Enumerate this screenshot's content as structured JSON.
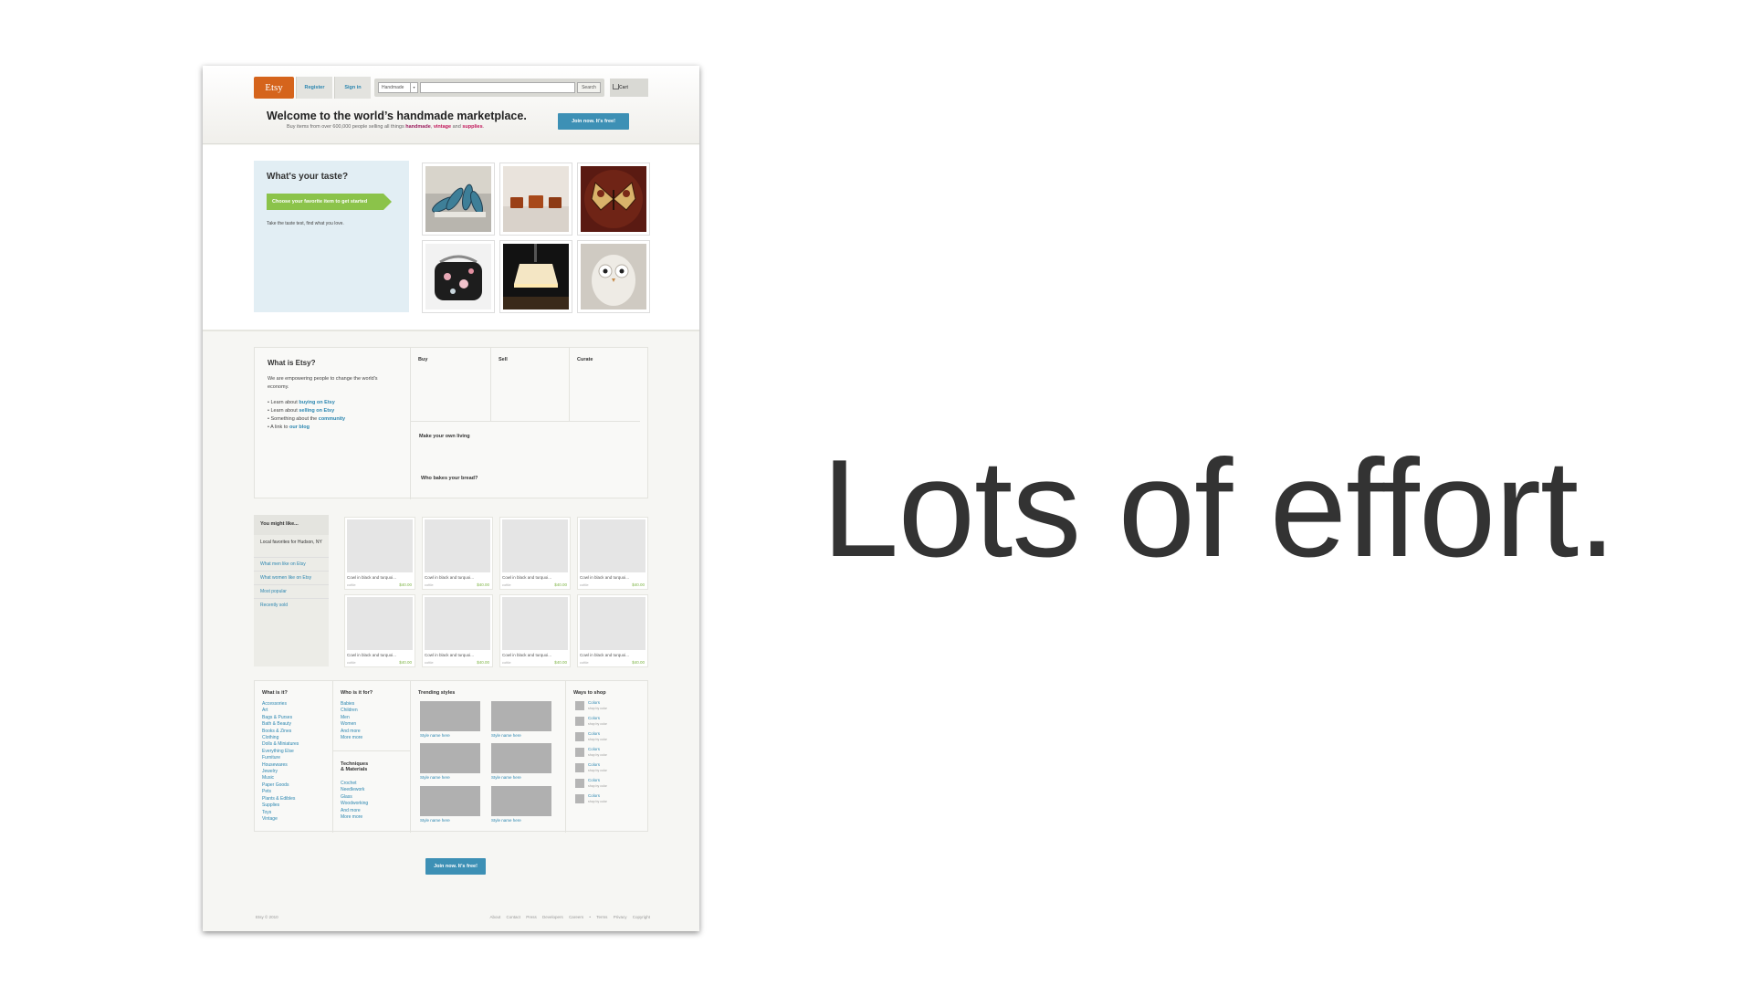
{
  "headline": "Lots of effort.",
  "colors": {
    "etsy_orange": "#d5641c",
    "link_blue": "#2b86b0",
    "join_blue": "#3d90b5",
    "cta_green": "#8bc34a",
    "price_green": "#7cb342"
  },
  "header": {
    "logo": "Etsy",
    "register": "Register",
    "sign_in": "Sign in",
    "search_category": "Handmade",
    "search_button": "Search",
    "search_value": "",
    "cart": "Cart",
    "cart_icon": "cart-icon",
    "welcome_title": "Welcome to the world’s handmade marketplace.",
    "welcome_sub_prefix": "Buy items from over 600,000 people selling all things",
    "welcome_handmade": "handmade",
    "welcome_sep1": ",",
    "welcome_vintage": "vintage",
    "welcome_and": "and",
    "welcome_supplies": "supplies",
    "welcome_end": ".",
    "join": "Join now. It's free!"
  },
  "taste": {
    "title": "What's your taste?",
    "cta": "Choose your favorite item to get started",
    "note": "Take the taste test, find what you love."
  },
  "what_is_etsy": {
    "title": "What is Etsy?",
    "description": "We are empowering people to change the world's economy.",
    "items": [
      {
        "prefix": "Learn about",
        "link": "buying on Etsy"
      },
      {
        "prefix": "Learn about",
        "link": "selling on Etsy"
      },
      {
        "prefix": "Something about the",
        "link": "community"
      },
      {
        "prefix": "A link to",
        "link": "our blog"
      }
    ],
    "columns": [
      "Buy",
      "Sell",
      "Curate"
    ],
    "make_living": "Make your own living",
    "bread": "Who bakes your bread?"
  },
  "sidebar": {
    "title": "You might like...",
    "local": "Local favorites for Hudson, NY",
    "items": [
      "What men like on Etsy",
      "What women like on Etsy",
      "Most popular",
      "Recently sold"
    ]
  },
  "products": [
    {
      "name": "Cowl in black and turquoi...",
      "shop": "cottle",
      "price": "$40.00"
    },
    {
      "name": "Cowl in black and turquoi...",
      "shop": "cottle",
      "price": "$40.00"
    },
    {
      "name": "Cowl in black and turquoi...",
      "shop": "cottle",
      "price": "$40.00"
    },
    {
      "name": "Cowl in black and turquoi...",
      "shop": "cottle",
      "price": "$40.00"
    },
    {
      "name": "Cowl in black and turquoi...",
      "shop": "cottle",
      "price": "$40.00"
    },
    {
      "name": "Cowl in black and turquoi...",
      "shop": "cottle",
      "price": "$40.00"
    },
    {
      "name": "Cowl in black and turquoi...",
      "shop": "cottle",
      "price": "$40.00"
    },
    {
      "name": "Cowl in black and turquoi...",
      "shop": "cottle",
      "price": "$40.00"
    }
  ],
  "footer_nav": {
    "what_title": "What is it?",
    "what_links": [
      "Accessories",
      "Art",
      "Bags & Purses",
      "Bath & Beauty",
      "Books & Zines",
      "Clothing",
      "Dolls & Miniatures",
      "Everything Else",
      "Furniture",
      "Housewares",
      "Jewelry",
      "Music",
      "Paper Goods",
      "Pets",
      "Plants & Edibles",
      "Supplies",
      "Toys",
      "Vintage"
    ],
    "who_title": "Who is it for?",
    "who_links": [
      "Babies",
      "Children",
      "Men",
      "Women",
      "And more",
      "More more"
    ],
    "tech_title_1": "Techniques",
    "tech_title_2": "& Materials",
    "tech_links": [
      "Crochet",
      "Needlework",
      "Glass",
      "Woodworking",
      "And more",
      "More more"
    ],
    "trending_title": "Trending styles",
    "trending": [
      "Style name here",
      "Style name here",
      "Style name here",
      "Style name here",
      "Style name here",
      "Style name here"
    ],
    "ways_title": "Ways to shop",
    "ways": [
      {
        "title": "Colors",
        "sub": "shop by color"
      },
      {
        "title": "Colors",
        "sub": "shop by color"
      },
      {
        "title": "Colors",
        "sub": "shop by color"
      },
      {
        "title": "Colors",
        "sub": "shop by color"
      },
      {
        "title": "Colors",
        "sub": "shop by color"
      },
      {
        "title": "Colors",
        "sub": "shop by color"
      },
      {
        "title": "Colors",
        "sub": "shop by color"
      }
    ]
  },
  "bottom": {
    "join": "Join now. It's free!",
    "copyright": "Etsy © 2010",
    "links": [
      "About",
      "Contact",
      "Press",
      "Developers",
      "Careers",
      "•",
      "Terms",
      "Privacy",
      "Copyright"
    ]
  }
}
